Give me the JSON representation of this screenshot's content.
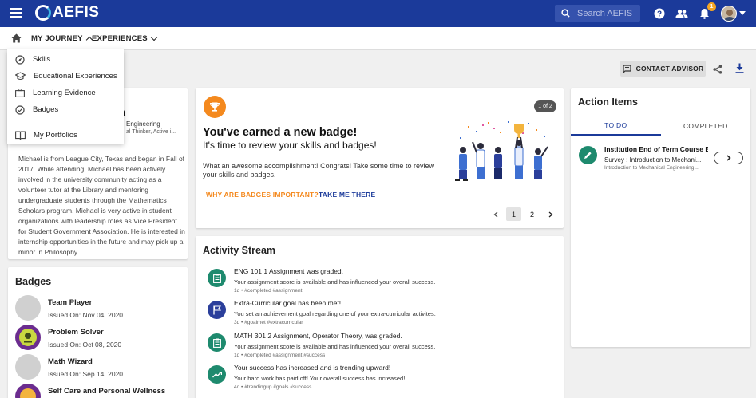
{
  "topbar": {
    "logo_text": "AEFIS",
    "search_placeholder": "Search AEFIS",
    "notification_count": "1",
    "bg_color": "#1b3a9a"
  },
  "nav": {
    "my_journey": "MY JOURNEY",
    "experiences": "EXPERIENCES"
  },
  "dropdown": {
    "items": [
      {
        "label": "Skills",
        "icon": "compass-icon"
      },
      {
        "label": "Educational Experiences",
        "icon": "graduation-cap-icon"
      },
      {
        "label": "Learning Evidence",
        "icon": "briefcase-icon"
      },
      {
        "label": "Badges",
        "icon": "check-badge-icon"
      }
    ],
    "portfolios": "My Portfolios"
  },
  "toolbar": {
    "contact_advisor": "CONTACT ADVISOR"
  },
  "profile": {
    "frag_name": "t",
    "frag_major": "Engineering",
    "frag_traits": "al Thinker, Active i...",
    "bio": "Michael is from League City, Texas and began in Fall of 2017. While attending, Michael has been actively involved in the university community acting as a volunteer tutor at the Library and mentoring undergraduate students through the Mathematics Scholars program. Michael is very active in student organizations with leadership roles as Vice President for Student Government Association. He is interested in internship opportunities in the future and may pick up a minor in Philosophy."
  },
  "badges": {
    "title": "Badges",
    "items": [
      {
        "name": "Team Player",
        "date": "Issued On: Nov 04, 2020"
      },
      {
        "name": "Problem Solver",
        "date": "Issued On: Oct 08, 2020"
      },
      {
        "name": "Math Wizard",
        "date": "Issued On: Sep 14, 2020"
      },
      {
        "name": "Self Care and Personal Wellness",
        "date": ""
      }
    ]
  },
  "promo": {
    "page_indicator": "1 of 2",
    "title": "You've earned a new badge!",
    "subtitle": "It's time to review your skills and badges!",
    "body": "What an awesome accomplishment! Congrats! Take some time to review your skills and badges.",
    "link_why": "WHY ARE BADGES IMPORTANT?",
    "link_take": "TAKE ME THERE",
    "pages": [
      "1",
      "2"
    ]
  },
  "activity": {
    "title": "Activity Stream",
    "items": [
      {
        "title": "ENG 101 1 Assignment was graded.",
        "desc": "Your assignment score is available and has influenced your overall success.",
        "meta": "1d • #completed #assignment",
        "icon": "clipboard-icon",
        "color": "#1e8a6e"
      },
      {
        "title": "Extra-Curricular goal has been met!",
        "desc": "You set an achievement goal regarding one of your extra-curricular activites.",
        "meta": "3d • #goalmet #extracurricular",
        "icon": "flag-icon",
        "color": "#2b3f9b"
      },
      {
        "title": "MATH 301 2 Assignment, Operator Theory, was graded.",
        "desc": "Your assignment score is available and has influenced your overall success.",
        "meta": "1d • #completed #assignment #success",
        "icon": "clipboard-icon",
        "color": "#1e8a6e"
      },
      {
        "title": "Your success has increased and is trending upward!",
        "desc": "Your hard work has paid off! Your overall success has increased!",
        "meta": "4d • #trendingup #goals #success",
        "icon": "trending-up-icon",
        "color": "#1e8a6e"
      }
    ]
  },
  "action_items": {
    "title": "Action Items",
    "tab_todo": "TO DO",
    "tab_completed": "COMPLETED",
    "item": {
      "title": "Institution End of Term Course E...",
      "sub": "Survey : Introduction to Mechani...",
      "meta": "Introduction to Mechanical Engineering..."
    }
  }
}
